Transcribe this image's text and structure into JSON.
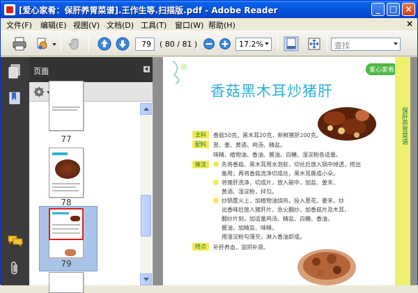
{
  "window": {
    "title": "[爱心家肴：保肝养胃菜谱].王作生等.扫描版.pdf - Adobe Reader",
    "caption_minimize": "_",
    "caption_maximize": "□",
    "caption_close": "×"
  },
  "menu": {
    "items": [
      "文件(F)",
      "编辑(E)",
      "视图(V)",
      "文档(D)",
      "工具(T)",
      "窗口(W)",
      "帮助(H)"
    ],
    "close_doc": "×"
  },
  "toolbar": {
    "page_number": "79",
    "page_count": "( 80 / 81 )",
    "zoom": "17.2%",
    "search_placeholder": "查找"
  },
  "navigation_panel": {
    "title": "页面",
    "thumbnails": [
      {
        "label": "77"
      },
      {
        "label": "78"
      },
      {
        "label": "79",
        "selected": true
      }
    ]
  },
  "document_page": {
    "section_tag": "爱心家肴",
    "recipe_title": "香菇黑木耳炒猪肝",
    "side_strip_text": "保肝养胃菜谱",
    "labels": [
      "主料",
      "配料",
      "做法",
      "特点"
    ],
    "lines": [
      "香菇50克，黑木耳20克，新鲜猪肝200克。",
      "葱、姜、黄酒、鸡汤、精盐。",
      "味精、植物油、香油、酱油、白糖、湿淀粉各适量。",
      "先将香菇、黑木耳用水泡软，切丝后放入锅中焯透，捞出",
      "备用；再将香菇洗净切成丝，黑木耳撕成小朵。",
      "将猪肝洗净，切成片，放入碗中，加盐、姜末、",
      "黄酒、湿淀粉，拌匀。",
      "炒锅置火上，加植物油烧热，投入葱花、姜末，炒",
      "出香味后放入猪肝片，急火翻炒，加香菇片及木耳，",
      "翻炒片刻，加适量鸡汤、精盐、白糖、香油，",
      "酱油，加精盐、味精，",
      "用湿淀粉勾薄芡，淋入香油即成。",
      "补肝养血，滋阴补肾。"
    ]
  },
  "colors": {
    "titlebar": "#0655e0",
    "title_text": "#2fb0d6",
    "label_bg": "#f5ea52",
    "strip": "#eef070",
    "selected_thumb_bg": "#a8c4e8"
  }
}
